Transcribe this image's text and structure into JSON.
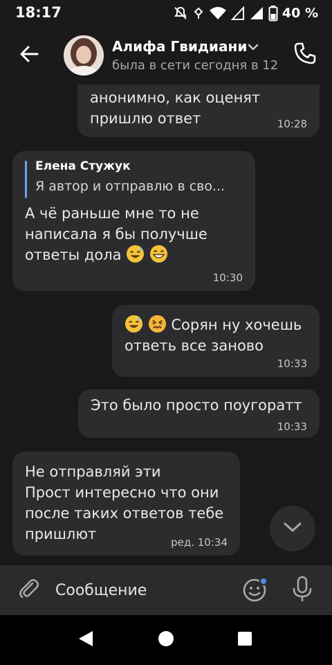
{
  "status_bar": {
    "time": "18:17",
    "battery_percent": "40 %",
    "icons": [
      "mute-icon",
      "vibrate-icon",
      "wifi-icon",
      "signal-icon",
      "battery-icon"
    ]
  },
  "header": {
    "contact_name": "Алифа Гвидиани",
    "last_seen": "была в сети сегодня в 12",
    "icons": [
      "back-arrow-icon",
      "avatar",
      "chevron-down-icon",
      "phone-icon"
    ]
  },
  "messages": [
    {
      "id": 1,
      "direction": "outgoing",
      "lines": [
        "анонимно, как оценят",
        "пришлю ответ"
      ],
      "time": "10:28"
    },
    {
      "id": 2,
      "direction": "incoming",
      "reply": {
        "author": "Елена Стужук",
        "text": "Я автор и отправлю в сво..."
      },
      "lines": [
        "А чё раньше мне то не",
        "написала я бы получше",
        "ответы дола"
      ],
      "emojis_after": [
        "sweat-smile-emoji",
        "grin-emoji"
      ],
      "time": "10:30"
    },
    {
      "id": 3,
      "direction": "outgoing",
      "emojis_before": [
        "sweat-smile-emoji",
        "confounded-emoji"
      ],
      "lines": [
        "Сорян ну хочешь",
        "ответь все заново"
      ],
      "time": "10:33"
    },
    {
      "id": 4,
      "direction": "outgoing",
      "lines": [
        "Это было просто поугоратт"
      ],
      "time": "10:33"
    },
    {
      "id": 5,
      "direction": "incoming",
      "lines": [
        "Не отправляй эти",
        "Прост интересно что они",
        "после таких ответов тебе",
        "пришлют"
      ],
      "time": "ред. 10:34"
    }
  ],
  "composer": {
    "placeholder": "Сообщение",
    "icons": [
      "paperclip-icon",
      "sticker-icon",
      "microphone-icon"
    ]
  },
  "nav_bar": {
    "icons": [
      "back-triangle-icon",
      "home-circle-icon",
      "recents-square-icon"
    ]
  },
  "colors": {
    "background": "#19191a",
    "bubble": "#2c2c2e",
    "accent": "#6fa3ef",
    "secondary_text": "#a8a8ac"
  }
}
